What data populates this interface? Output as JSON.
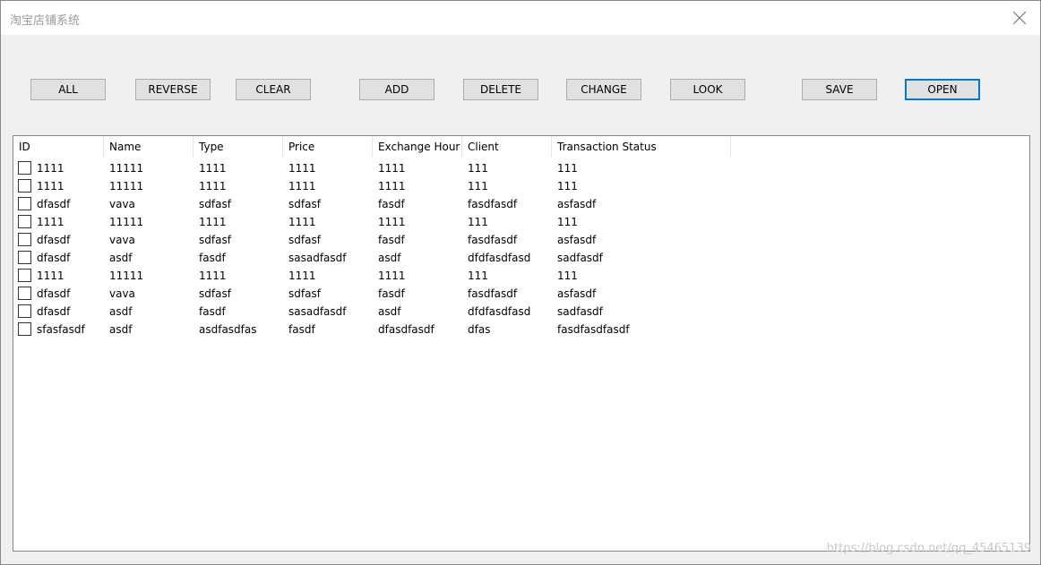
{
  "window": {
    "title": "淘宝店铺系统"
  },
  "toolbar": {
    "all_label": "ALL",
    "reverse_label": "REVERSE",
    "clear_label": "CLEAR",
    "add_label": "ADD",
    "delete_label": "DELETE",
    "change_label": "CHANGE",
    "look_label": "LOOK",
    "save_label": "SAVE",
    "open_label": "OPEN"
  },
  "table": {
    "columns": [
      "ID",
      "Name",
      "Type",
      "Price",
      "Exchange Hour",
      "Client",
      "Transaction Status"
    ],
    "rows": [
      [
        "1111",
        "11111",
        "1111",
        "1111",
        "1111",
        "111",
        "111"
      ],
      [
        "1111",
        "11111",
        "1111",
        "1111",
        "1111",
        "111",
        "111"
      ],
      [
        "dfasdf",
        "vava",
        "sdfasf",
        "sdfasf",
        "fasdf",
        "fasdfasdf",
        "asfasdf"
      ],
      [
        "1111",
        "11111",
        "1111",
        "1111",
        "1111",
        "111",
        "111"
      ],
      [
        "dfasdf",
        "vava",
        "sdfasf",
        "sdfasf",
        "fasdf",
        "fasdfasdf",
        "asfasdf"
      ],
      [
        "dfasdf",
        "asdf",
        "fasdf",
        "sasadfasdf",
        "asdf",
        "dfdfasdfasd",
        "sadfasdf"
      ],
      [
        "1111",
        "11111",
        "1111",
        "1111",
        "1111",
        "111",
        "111"
      ],
      [
        "dfasdf",
        "vava",
        "sdfasf",
        "sdfasf",
        "fasdf",
        "fasdfasdf",
        "asfasdf"
      ],
      [
        "dfasdf",
        "asdf",
        "fasdf",
        "sasadfasdf",
        "asdf",
        "dfdfasdfasd",
        "sadfasdf"
      ],
      [
        "sfasfasdf",
        "asdf",
        "asdfasdfas",
        "fasdf",
        "dfasdfasdf",
        "dfas",
        "fasdfasdfasdf"
      ]
    ]
  },
  "watermark": "https://blog.csdn.net/qq_45465139"
}
